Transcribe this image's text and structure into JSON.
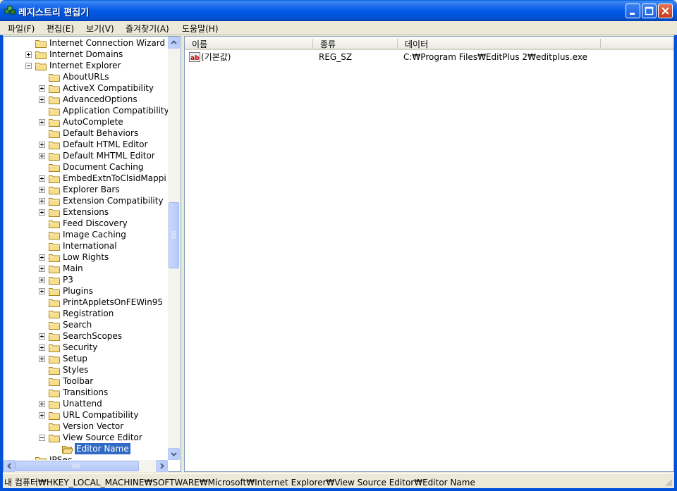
{
  "window": {
    "title": "레지스트리 편집기"
  },
  "menu": [
    "파일(F)",
    "편집(E)",
    "보기(V)",
    "즐겨찾기(A)",
    "도움말(H)"
  ],
  "tree": {
    "items": [
      {
        "label": "Internet Connection Wizard",
        "expander": "none"
      },
      {
        "label": "Internet Domains",
        "expander": "plus"
      },
      {
        "label": "Internet Explorer",
        "expander": "minus"
      },
      {
        "label": "AboutURLs",
        "expander": "none"
      },
      {
        "label": "ActiveX Compatibility",
        "expander": "plus"
      },
      {
        "label": "AdvancedOptions",
        "expander": "plus"
      },
      {
        "label": "Application Compatibility",
        "expander": "none"
      },
      {
        "label": "AutoComplete",
        "expander": "plus"
      },
      {
        "label": "Default Behaviors",
        "expander": "none"
      },
      {
        "label": "Default HTML Editor",
        "expander": "plus"
      },
      {
        "label": "Default MHTML Editor",
        "expander": "plus"
      },
      {
        "label": "Document Caching",
        "expander": "none"
      },
      {
        "label": "EmbedExtnToClsidMappi",
        "expander": "plus"
      },
      {
        "label": "Explorer Bars",
        "expander": "plus"
      },
      {
        "label": "Extension Compatibility",
        "expander": "plus"
      },
      {
        "label": "Extensions",
        "expander": "plus"
      },
      {
        "label": "Feed Discovery",
        "expander": "none"
      },
      {
        "label": "Image Caching",
        "expander": "none"
      },
      {
        "label": "International",
        "expander": "none"
      },
      {
        "label": "Low Rights",
        "expander": "plus"
      },
      {
        "label": "Main",
        "expander": "plus"
      },
      {
        "label": "P3",
        "expander": "plus"
      },
      {
        "label": "Plugins",
        "expander": "plus"
      },
      {
        "label": "PrintAppletsOnFEWin95",
        "expander": "none"
      },
      {
        "label": "Registration",
        "expander": "none"
      },
      {
        "label": "Search",
        "expander": "none"
      },
      {
        "label": "SearchScopes",
        "expander": "plus"
      },
      {
        "label": "Security",
        "expander": "plus"
      },
      {
        "label": "Setup",
        "expander": "plus"
      },
      {
        "label": "Styles",
        "expander": "none"
      },
      {
        "label": "Toolbar",
        "expander": "none"
      },
      {
        "label": "Transitions",
        "expander": "none"
      },
      {
        "label": "Unattend",
        "expander": "plus"
      },
      {
        "label": "URL Compatibility",
        "expander": "plus"
      },
      {
        "label": "Version Vector",
        "expander": "none"
      },
      {
        "label": "View Source Editor",
        "expander": "minus"
      },
      {
        "label": "Editor Name",
        "expander": "none",
        "selected": true
      },
      {
        "label": "IPSec",
        "expander": "none"
      }
    ]
  },
  "list": {
    "columns": [
      "이름",
      "종류",
      "데이터"
    ],
    "rows": [
      {
        "name": "(기본값)",
        "type": "REG_SZ",
        "data": "C:₩Program Files₩EditPlus 2₩editplus.exe",
        "icon": "string-value-icon"
      }
    ]
  },
  "status": {
    "path": "내 컴퓨터₩HKEY_LOCAL_MACHINE₩SOFTWARE₩Microsoft₩Internet Explorer₩View Source Editor₩Editor Name"
  }
}
